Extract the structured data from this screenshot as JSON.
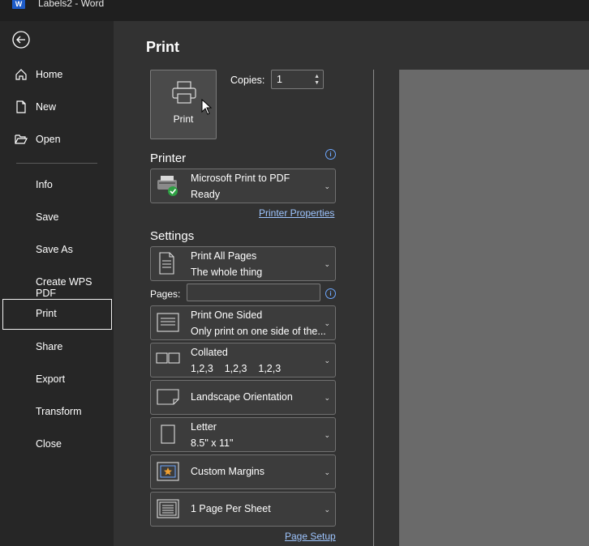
{
  "window": {
    "title": "Labels2  -  Word",
    "app_icon": "W"
  },
  "sidebar": {
    "top_items": [
      {
        "label": "Home"
      },
      {
        "label": "New"
      },
      {
        "label": "Open"
      }
    ],
    "items": [
      {
        "label": "Info"
      },
      {
        "label": "Save"
      },
      {
        "label": "Save As"
      },
      {
        "label": "Create WPS PDF"
      },
      {
        "label": "Print"
      },
      {
        "label": "Share"
      },
      {
        "label": "Export"
      },
      {
        "label": "Transform"
      },
      {
        "label": "Close"
      }
    ],
    "selected": "Print"
  },
  "print": {
    "heading": "Print",
    "button_label": "Print",
    "copies_label": "Copies:",
    "copies_value": "1"
  },
  "printer": {
    "section_label": "Printer",
    "name": "Microsoft Print to PDF",
    "status": "Ready",
    "properties_link": "Printer Properties"
  },
  "settings": {
    "section_label": "Settings",
    "pages_label": "Pages:",
    "pages_value": "",
    "range": {
      "title": "Print All Pages",
      "subtitle": "The whole thing"
    },
    "sides": {
      "title": "Print One Sided",
      "subtitle": "Only print on one side of the..."
    },
    "collation": {
      "title": "Collated",
      "subtitle": "1,2,3    1,2,3    1,2,3"
    },
    "orientation": {
      "title": "Landscape Orientation"
    },
    "paper": {
      "title": "Letter",
      "subtitle": "8.5\" x 11\""
    },
    "margins": {
      "title": "Custom Margins"
    },
    "per_sheet": {
      "title": "1 Page Per Sheet"
    },
    "page_setup_link": "Page Setup"
  },
  "colors": {
    "accent_link": "#9ec5ff",
    "info_icon": "#6ea8ff",
    "ready_check": "#2ea043"
  }
}
